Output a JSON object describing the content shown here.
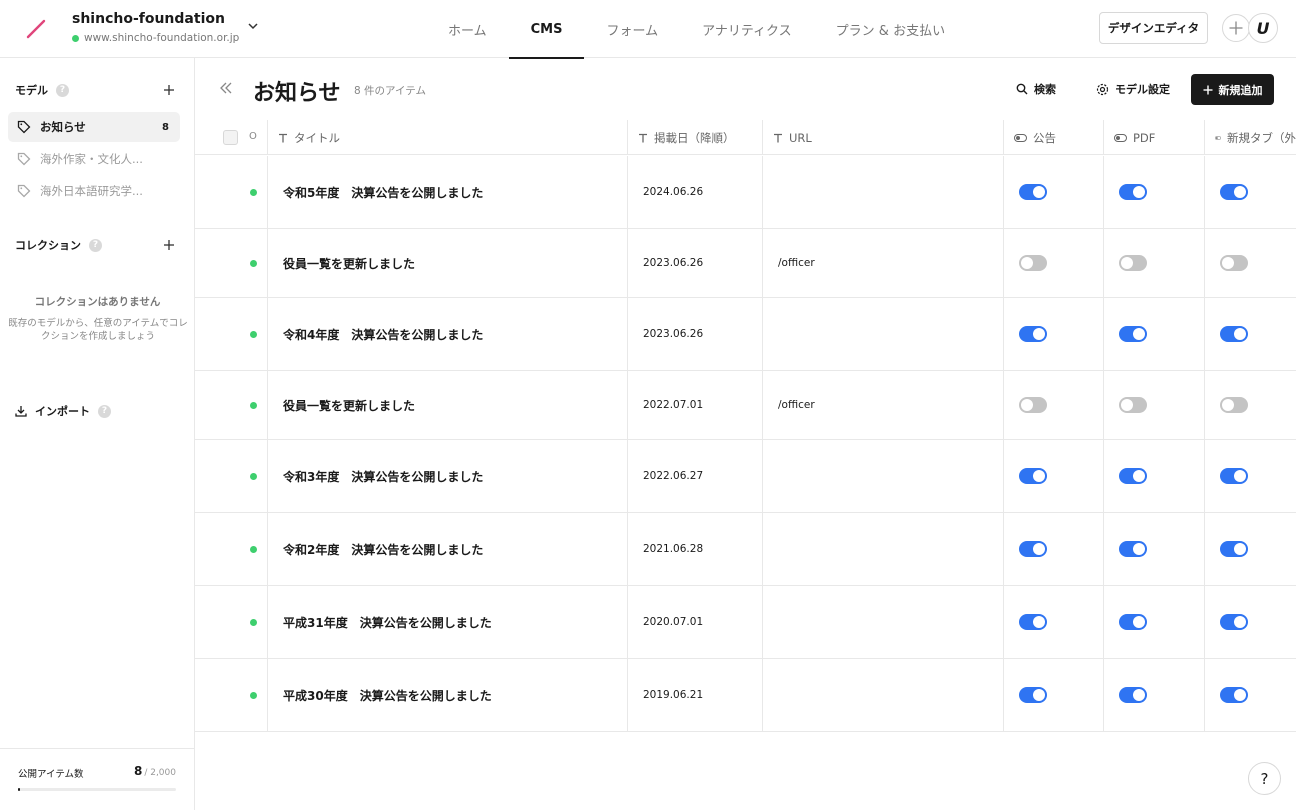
{
  "site": {
    "name": "shincho-foundation",
    "url": "www.shincho-foundation.or.jp"
  },
  "nav": [
    {
      "label": "ホーム",
      "active": false
    },
    {
      "label": "CMS",
      "active": true
    },
    {
      "label": "フォーム",
      "active": false
    },
    {
      "label": "アナリティクス",
      "active": false
    },
    {
      "label": "プラン & お支払い",
      "active": false
    }
  ],
  "header": {
    "design_editor": "デザインエディタ",
    "avatar_letter": "U"
  },
  "sidebar": {
    "models_heading": "モデル",
    "models": [
      {
        "label": "お知らせ",
        "count": "8",
        "active": true
      },
      {
        "label": "海外作家・文化人...",
        "count": "",
        "active": false
      },
      {
        "label": "海外日本語研究学...",
        "count": "",
        "active": false
      }
    ],
    "collections_heading": "コレクション",
    "empty_title": "コレクションはありません",
    "empty_desc": "既存のモデルから、任意のアイテムでコレクションを作成しましょう",
    "import_label": "インポート",
    "published_label": "公開アイテム数",
    "published_count": "8",
    "published_limit": "/ 2,000",
    "published_fraction": 0.004
  },
  "main": {
    "title": "お知らせ",
    "item_count": "8 件のアイテム",
    "search_label": "検索",
    "model_settings_label": "モデル設定",
    "add_label": "新規追加"
  },
  "table": {
    "columns": {
      "o": "O",
      "title": "タイトル",
      "date": "掲載日（降順）",
      "url": "URL",
      "notice": "公告",
      "pdf": "PDF",
      "newtab": "新規タブ（外"
    },
    "rows": [
      {
        "title": "令和5年度　決算公告を公開しました",
        "date": "2024.06.26",
        "url": "",
        "notice": true,
        "pdf": true,
        "newtab": true
      },
      {
        "title": "役員一覧を更新しました",
        "date": "2023.06.26",
        "url": "/officer",
        "notice": false,
        "pdf": false,
        "newtab": false
      },
      {
        "title": "令和4年度　決算公告を公開しました",
        "date": "2023.06.26",
        "url": "",
        "notice": true,
        "pdf": true,
        "newtab": true
      },
      {
        "title": "役員一覧を更新しました",
        "date": "2022.07.01",
        "url": "/officer",
        "notice": false,
        "pdf": false,
        "newtab": false
      },
      {
        "title": "令和3年度　決算公告を公開しました",
        "date": "2022.06.27",
        "url": "",
        "notice": true,
        "pdf": true,
        "newtab": true
      },
      {
        "title": "令和2年度　決算公告を公開しました",
        "date": "2021.06.28",
        "url": "",
        "notice": true,
        "pdf": true,
        "newtab": true
      },
      {
        "title": "平成31年度　決算公告を公開しました",
        "date": "2020.07.01",
        "url": "",
        "notice": true,
        "pdf": true,
        "newtab": true
      },
      {
        "title": "平成30年度　決算公告を公開しました",
        "date": "2019.06.21",
        "url": "",
        "notice": true,
        "pdf": true,
        "newtab": true
      }
    ]
  },
  "colors": {
    "accent": "#2f74f2",
    "published": "#3ecf6e",
    "brand": "#e0457b"
  },
  "icons": {
    "help": "?"
  }
}
